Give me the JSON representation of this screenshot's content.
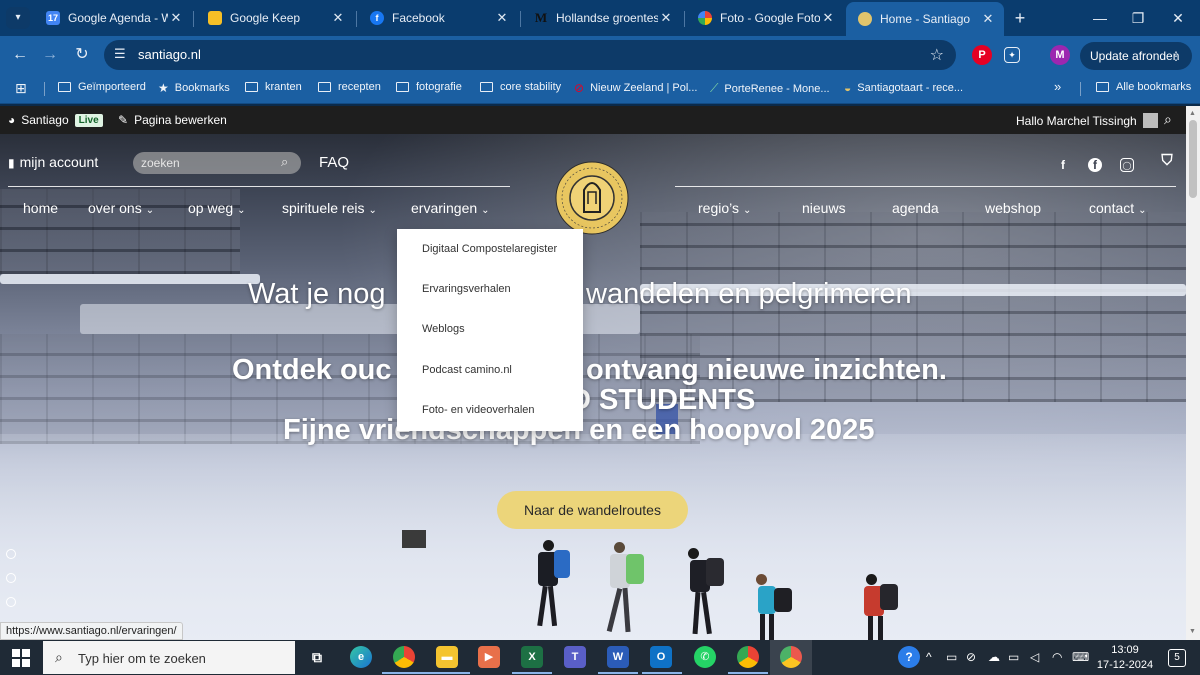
{
  "tabs": [
    {
      "title": "Google Agenda - We",
      "icon": "calendar-icon",
      "icon_text": "17",
      "color": "#4285f4"
    },
    {
      "title": "Google Keep",
      "icon": "keep-icon",
      "icon_text": "",
      "color": "#f6bf26"
    },
    {
      "title": "Facebook",
      "icon": "facebook-icon",
      "icon_text": "f",
      "color": "#1877f2"
    },
    {
      "title": "Hollandse groenteso",
      "icon": "m-icon",
      "icon_text": "M",
      "color": "#222222"
    },
    {
      "title": "Foto - Google Foto's",
      "icon": "photos-icon",
      "icon_text": "",
      "color": "#ea4335"
    },
    {
      "title": "Home - Santiago",
      "icon": "santiago-icon",
      "icon_text": "",
      "color": "#e0c46c"
    }
  ],
  "toolbar": {
    "url": "santiago.nl",
    "update_label": "Update afronden",
    "profile_initial": "M"
  },
  "bookmarks": [
    {
      "label": "Geïmporteerd",
      "icon": "folder-icon"
    },
    {
      "label": "Bookmarks",
      "icon": "star-icon"
    },
    {
      "label": "kranten",
      "icon": "folder-icon"
    },
    {
      "label": "recepten",
      "icon": "folder-icon"
    },
    {
      "label": "fotografie",
      "icon": "folder-icon"
    },
    {
      "label": "core stability",
      "icon": "folder-icon"
    },
    {
      "label": "Nieuw Zeeland | Pol...",
      "icon": "pinterest-icon"
    },
    {
      "label": "PorteRenee - Mone...",
      "icon": "feather-icon"
    },
    {
      "label": "Santiagotaart - rece...",
      "icon": "cake-icon"
    }
  ],
  "bookmarks_all": "Alle bookmarks",
  "adminbar": {
    "site": "Santiago",
    "live": "Live",
    "edit": "Pagina bewerken",
    "greeting": "Hallo Marchel Tissingh"
  },
  "site": {
    "account": "mijn account",
    "search_placeholder": "zoeken",
    "faq": "FAQ",
    "nav_left": [
      {
        "label": "home",
        "chevron": false
      },
      {
        "label": "over ons",
        "chevron": true
      },
      {
        "label": "op weg",
        "chevron": true
      },
      {
        "label": "spirituele reis",
        "chevron": true
      },
      {
        "label": "ervaringen",
        "chevron": true
      }
    ],
    "nav_right": [
      {
        "label": "regio’s",
        "chevron": true
      },
      {
        "label": "nieuws",
        "chevron": false
      },
      {
        "label": "agenda",
        "chevron": false
      },
      {
        "label": "webshop",
        "chevron": false
      },
      {
        "label": "contact",
        "chevron": true
      }
    ],
    "hero": {
      "line1_left": "Wat je nog",
      "line1_right": "wandelen en pelgrimeren",
      "line2_left": "Ontdek ouc",
      "line2_right": "ontvang nieuwe inzichten.",
      "line3_right": "D STUDENTS",
      "line4": "Fijne vriendschappen en een hoopvol 2025",
      "cta": "Naar de wandelroutes"
    },
    "dropdown": [
      "Digitaal Compostelaregister",
      "Ervaringsverhalen",
      "Weblogs",
      "Podcast camino.nl",
      "Foto- en videoverhalen"
    ]
  },
  "status_url": "https://www.santiago.nl/ervaringen/",
  "taskbar": {
    "search_placeholder": "Typ hier om te zoeken",
    "time": "13:09",
    "date": "17-12-2024",
    "notification_count": "5"
  }
}
